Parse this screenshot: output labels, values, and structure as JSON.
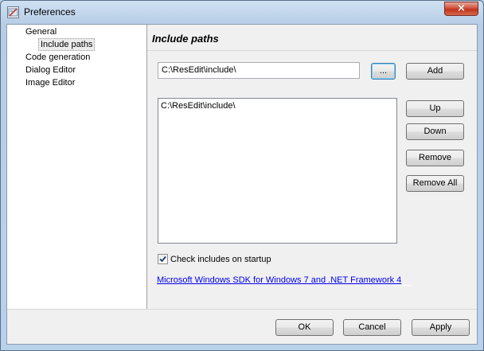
{
  "window": {
    "title": "Preferences",
    "close_glyph": "×"
  },
  "tree": {
    "items": [
      {
        "label": "General"
      },
      {
        "label": "Include paths"
      },
      {
        "label": "Code generation"
      },
      {
        "label": "Dialog Editor"
      },
      {
        "label": "Image Editor"
      }
    ]
  },
  "panel": {
    "title": "Include paths",
    "path_input_value": "C:\\ResEdit\\include\\",
    "browse_label": "...",
    "add_label": "Add",
    "list_items": [
      "C:\\ResEdit\\include\\"
    ],
    "up_label": "Up",
    "down_label": "Down",
    "remove_label": "Remove",
    "remove_all_label": "Remove All",
    "check_label": "Check includes on startup",
    "check_checked": true,
    "sdk_link": "Microsoft Windows SDK for Windows 7 and .NET Framework 4"
  },
  "footer": {
    "ok_label": "OK",
    "cancel_label": "Cancel",
    "apply_label": "Apply"
  },
  "icons": {
    "title": "preferences-icon",
    "check": "checkmark-icon"
  },
  "colors": {
    "link": "#0000ee",
    "close_button": "#c1301c",
    "frame": "#b9d1ea"
  }
}
